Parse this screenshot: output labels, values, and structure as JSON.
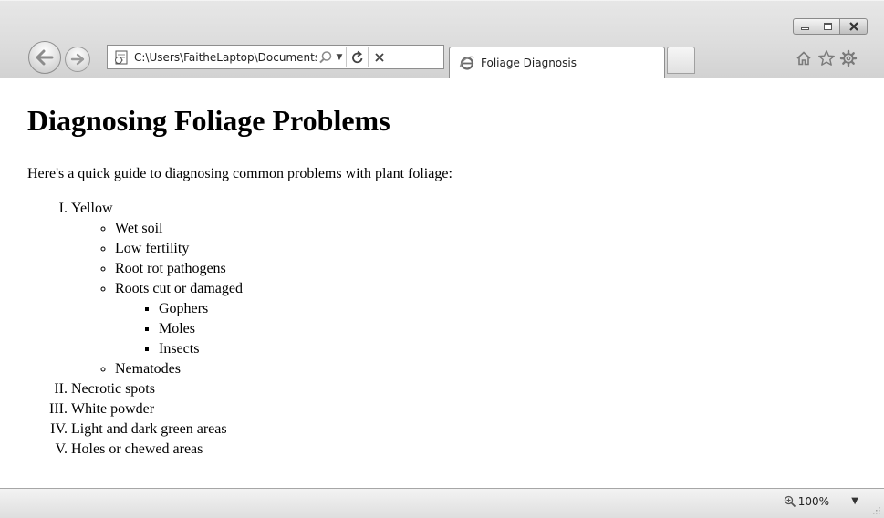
{
  "browser": {
    "address": "C:\\Users\\FaitheLaptop\\Documents\\",
    "tab_title": "Foliage Diagnosis",
    "zoom": "100%",
    "icons": {
      "back": "back-arrow-icon",
      "forward": "forward-arrow-icon",
      "page": "page-icon",
      "search": "search-icon",
      "refresh": "refresh-icon",
      "stop": "stop-icon",
      "tab": "ie-logo-icon",
      "home": "home-icon",
      "favorites": "star-icon",
      "tools": "gear-icon",
      "zoom": "magnifier-icon"
    }
  },
  "page": {
    "title": "Diagnosing Foliage Problems",
    "intro": "Here's a quick guide to diagnosing common problems with plant foliage:",
    "items": [
      {
        "label": "Yellow",
        "subitems": [
          {
            "label": "Wet soil"
          },
          {
            "label": "Low fertility"
          },
          {
            "label": "Root rot pathogens"
          },
          {
            "label": "Roots cut or damaged",
            "subitems": [
              "Gophers",
              "Moles",
              "Insects"
            ]
          },
          {
            "label": "Nematodes"
          }
        ]
      },
      {
        "label": "Necrotic spots"
      },
      {
        "label": "White powder"
      },
      {
        "label": "Light and dark green areas"
      },
      {
        "label": "Holes or chewed areas"
      }
    ]
  }
}
